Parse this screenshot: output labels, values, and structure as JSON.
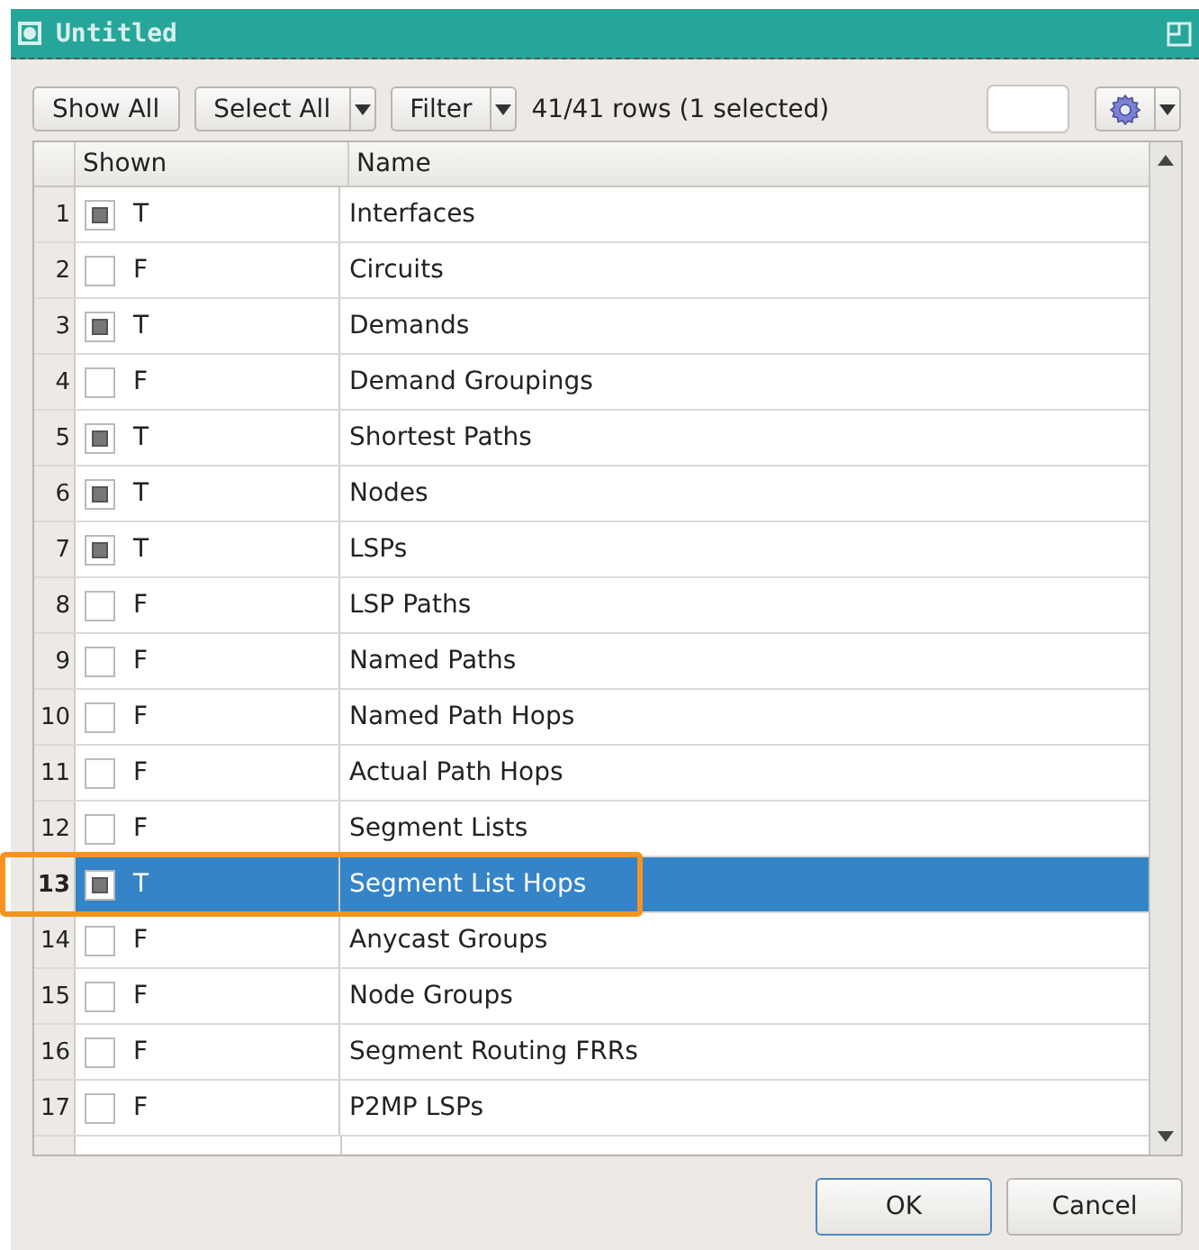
{
  "window": {
    "title": "Untitled"
  },
  "toolbar": {
    "show_all": "Show All",
    "select_all": "Select All",
    "filter": "Filter",
    "status": "41/41 rows (1 selected)"
  },
  "table": {
    "columns": [
      "Shown",
      "Name"
    ],
    "rows": [
      {
        "number": "1",
        "checked": true,
        "shown": "T",
        "name": "Interfaces",
        "selected": false
      },
      {
        "number": "2",
        "checked": false,
        "shown": "F",
        "name": "Circuits",
        "selected": false
      },
      {
        "number": "3",
        "checked": true,
        "shown": "T",
        "name": "Demands",
        "selected": false
      },
      {
        "number": "4",
        "checked": false,
        "shown": "F",
        "name": "Demand Groupings",
        "selected": false
      },
      {
        "number": "5",
        "checked": true,
        "shown": "T",
        "name": "Shortest Paths",
        "selected": false
      },
      {
        "number": "6",
        "checked": true,
        "shown": "T",
        "name": "Nodes",
        "selected": false
      },
      {
        "number": "7",
        "checked": true,
        "shown": "T",
        "name": "LSPs",
        "selected": false
      },
      {
        "number": "8",
        "checked": false,
        "shown": "F",
        "name": "LSP Paths",
        "selected": false
      },
      {
        "number": "9",
        "checked": false,
        "shown": "F",
        "name": "Named Paths",
        "selected": false
      },
      {
        "number": "10",
        "checked": false,
        "shown": "F",
        "name": "Named Path Hops",
        "selected": false
      },
      {
        "number": "11",
        "checked": false,
        "shown": "F",
        "name": "Actual Path Hops",
        "selected": false
      },
      {
        "number": "12",
        "checked": false,
        "shown": "F",
        "name": "Segment Lists",
        "selected": false
      },
      {
        "number": "13",
        "checked": true,
        "shown": "T",
        "name": "Segment List Hops",
        "selected": true
      },
      {
        "number": "14",
        "checked": false,
        "shown": "F",
        "name": "Anycast Groups",
        "selected": false
      },
      {
        "number": "15",
        "checked": false,
        "shown": "F",
        "name": "Node Groups",
        "selected": false
      },
      {
        "number": "16",
        "checked": false,
        "shown": "F",
        "name": "Segment Routing FRRs",
        "selected": false
      },
      {
        "number": "17",
        "checked": false,
        "shown": "F",
        "name": "P2MP LSPs",
        "selected": false
      }
    ]
  },
  "buttons": [
    "OK",
    "Cancel"
  ]
}
